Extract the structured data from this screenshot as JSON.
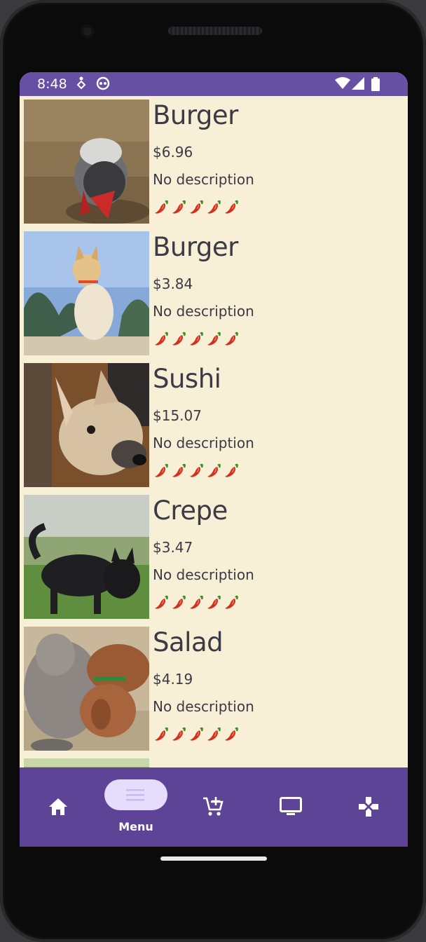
{
  "status_bar": {
    "time": "8:48",
    "icons": [
      "accessibility-icon",
      "app-notification-icon",
      "wifi-icon",
      "signal-icon",
      "battery-icon"
    ],
    "background": "#6550a3"
  },
  "menu": {
    "items": [
      {
        "name": "Burger",
        "price": "$6.96",
        "description": "No description",
        "spice_level": 5,
        "image": "dog-photo-keeshond"
      },
      {
        "name": "Burger",
        "price": "$3.84",
        "description": "No description",
        "spice_level": 5,
        "image": "dog-photo-akita"
      },
      {
        "name": "Sushi",
        "price": "$15.07",
        "description": "No description",
        "spice_level": 5,
        "image": "dog-photo-puppy-closeup"
      },
      {
        "name": "Crepe",
        "price": "$3.47",
        "description": "No description",
        "spice_level": 5,
        "image": "dog-photo-black-dog"
      },
      {
        "name": "Salad",
        "price": "$4.19",
        "description": "No description",
        "spice_level": 5,
        "image": "dog-photo-two-dogs"
      }
    ],
    "background": "#f7efd6"
  },
  "bottom_nav": {
    "items": [
      {
        "id": "home",
        "icon": "home-icon",
        "label": ""
      },
      {
        "id": "menu",
        "icon": "menu-icon",
        "label": "Menu",
        "selected": true
      },
      {
        "id": "cart",
        "icon": "add-shopping-cart-icon",
        "label": ""
      },
      {
        "id": "tv",
        "icon": "monitor-icon",
        "label": ""
      },
      {
        "id": "games",
        "icon": "gamepad-icon",
        "label": ""
      }
    ],
    "background": "#5e4497",
    "selected_pill": "#e6dcfb"
  }
}
